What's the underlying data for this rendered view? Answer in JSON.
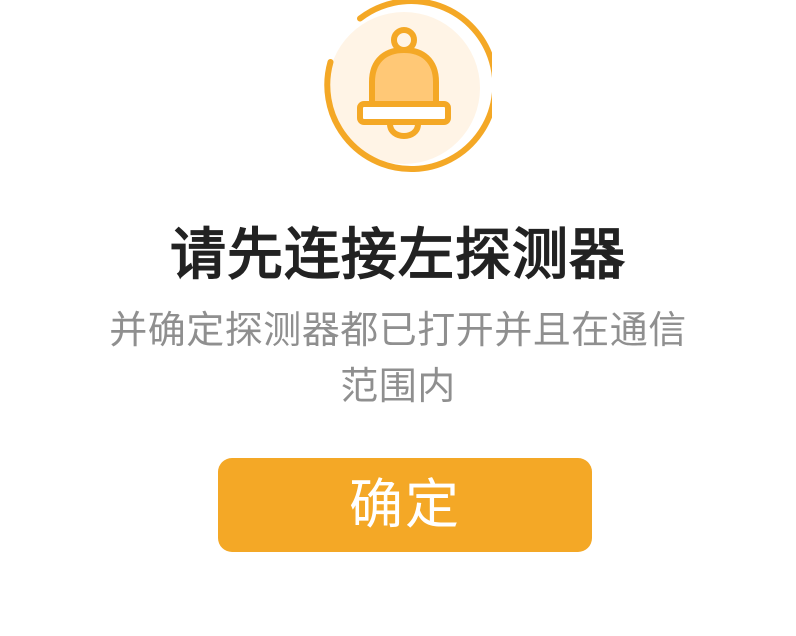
{
  "dialog": {
    "icon": "bell-icon",
    "title": "请先连接左探测器",
    "message": "并确定探测器都已打开并且在通信范围内",
    "confirm_label": "确定"
  },
  "colors": {
    "accent": "#f4a826",
    "accent_light": "#ffc876",
    "accent_bg": "#fff4e6",
    "title_text": "#222222",
    "message_text": "#8f8f8f",
    "button_text": "#ffffff"
  }
}
